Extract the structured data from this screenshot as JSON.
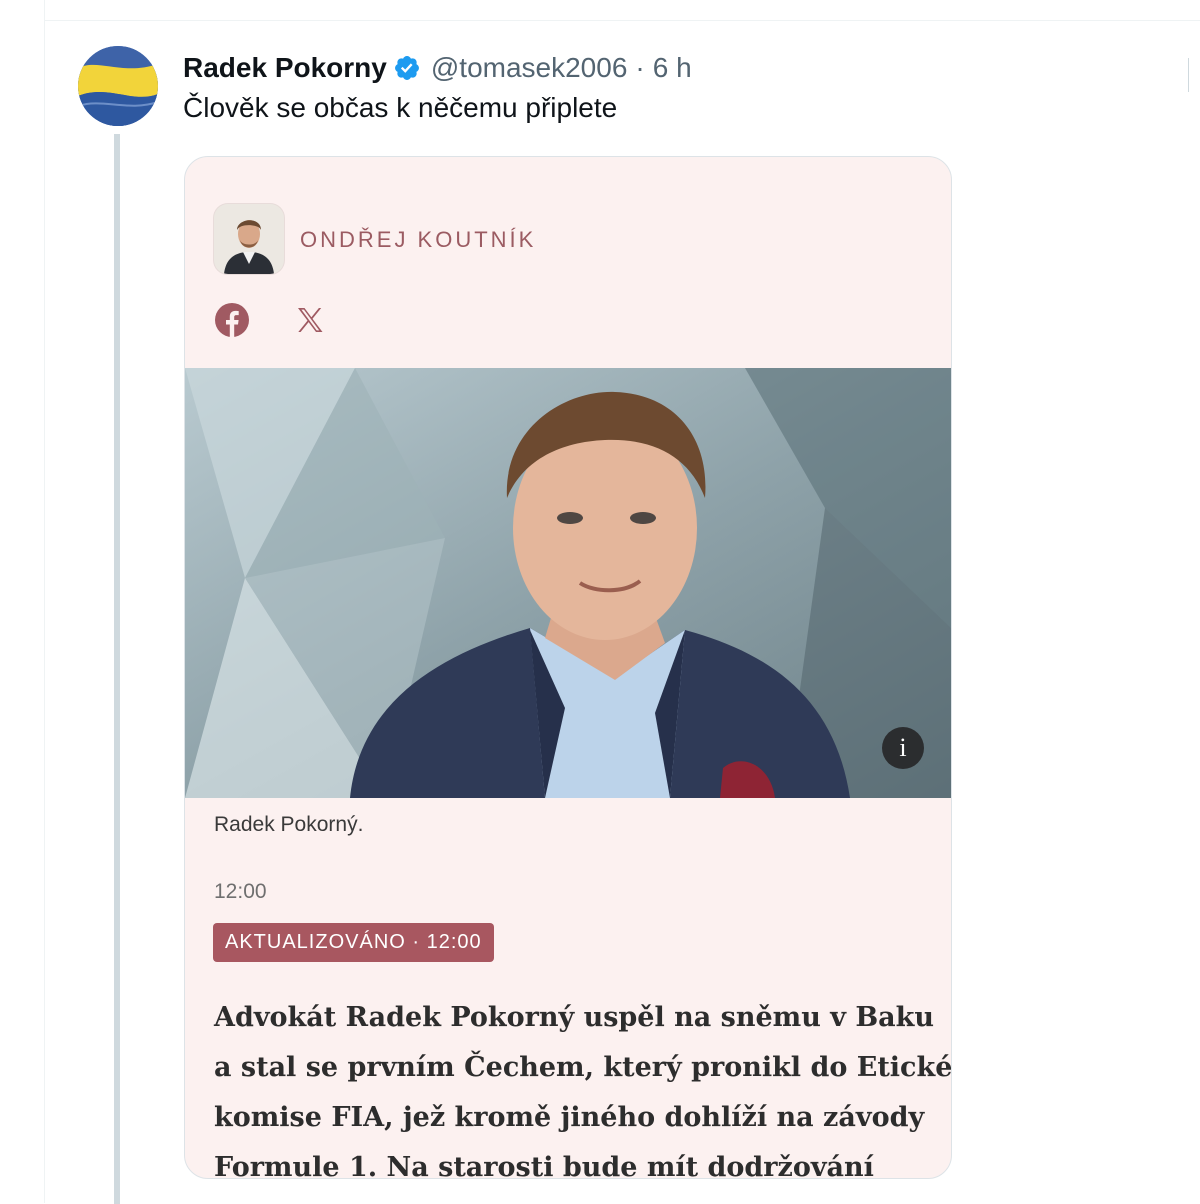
{
  "tweet": {
    "author_name": "Radek Pokorny",
    "handle": "@tomasek2006",
    "separator": "·",
    "time": "6 h",
    "text": "Člověk se občas k něčemu připlete",
    "verified": true
  },
  "card": {
    "author_label": "ONDŘEJ KOUTNÍK",
    "share_icons": [
      "facebook-icon",
      "x-icon"
    ],
    "info_symbol": "i",
    "caption": "Radek Pokorný.",
    "timestamp": "12:00",
    "updated_badge": "AKTUALIZOVÁNO · 12:00",
    "lead_lines": [
      "Advokát Radek Pokorný uspěl na sněmu v Baku",
      "a stal se prvním Čechem, který pronikl do Etické",
      "komise FIA, jež kromě jiného dohlíží na závody",
      "Formule 1. Na starosti bude mít dodržování"
    ]
  },
  "colors": {
    "verified_blue": "#1d9bf0",
    "card_background": "#fcf1f0",
    "author_label": "#9b5b62",
    "badge_background": "#a85760",
    "thread_line": "#cfd9de"
  }
}
